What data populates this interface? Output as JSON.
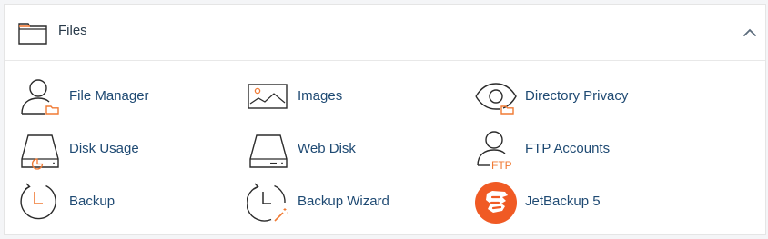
{
  "panel": {
    "title": "Files",
    "header_icon": "folder-icon",
    "collapse_icon": "chevron-up-icon"
  },
  "colors": {
    "accent": "#f07a34",
    "link": "#1f4a73",
    "icon_stroke": "#2b2b2b",
    "jetbackup": "#f05a24"
  },
  "items": [
    {
      "label": "File Manager",
      "icon": "user-folder-icon"
    },
    {
      "label": "Images",
      "icon": "image-icon"
    },
    {
      "label": "Directory Privacy",
      "icon": "eye-folder-icon"
    },
    {
      "label": "Disk Usage",
      "icon": "disk-chart-icon"
    },
    {
      "label": "Web Disk",
      "icon": "hard-drive-icon"
    },
    {
      "label": "FTP Accounts",
      "icon": "user-ftp-icon"
    },
    {
      "label": "Backup",
      "icon": "clock-backup-icon"
    },
    {
      "label": "Backup Wizard",
      "icon": "clock-wand-icon"
    },
    {
      "label": "JetBackup 5",
      "icon": "jetbackup-logo-icon"
    }
  ],
  "ftp_badge": "FTP"
}
